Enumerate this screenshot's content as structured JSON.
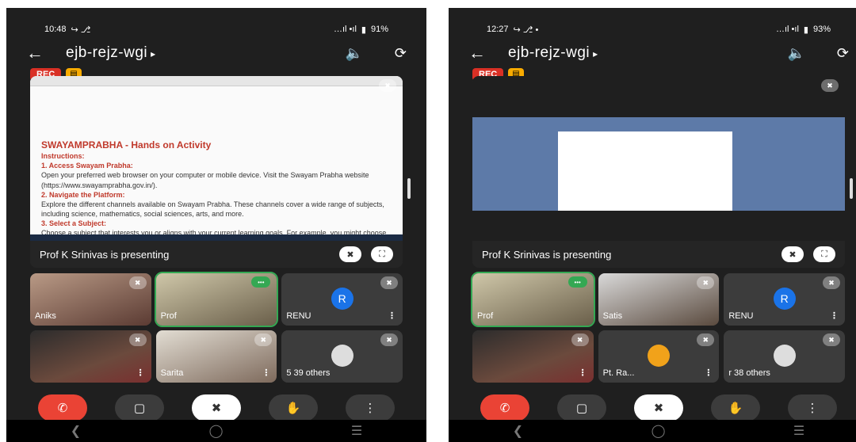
{
  "left": {
    "time": "10:48",
    "status_icons": "↪ ⎇",
    "signal": "…ıl •ıl",
    "battery": "91%",
    "meeting_code": "ejb-rejz-wgi",
    "rec": "REC",
    "presenting": "Prof K Srinivas is presenting",
    "doc_title": "SWAYAMPRABHA - Hands on Activity",
    "doc_instructions": "Instructions:",
    "doc_step1": "1. Access Swayam Prabha:",
    "doc_step1_text": "Open your preferred web browser on your computer or mobile device. Visit the Swayam Prabha website (https://www.swayamprabha.gov.in/).",
    "doc_step2": "2. Navigate the Platform:",
    "doc_step2_text": "Explore the different channels available on Swayam Prabha. These channels cover a wide range of subjects, including science, mathematics, social sciences, arts, and more.",
    "doc_step3": "3. Select a Subject:",
    "doc_step3_text": "Choose a subject that interests you or aligns with your current learning goals. For example, you might choose a channel related to your school or",
    "participants": [
      {
        "name": "Aniks"
      },
      {
        "name": "Prof"
      },
      {
        "name": "RENU",
        "initial": "R"
      },
      {
        "name": ""
      },
      {
        "name": "Sarita"
      },
      {
        "name": "5 39 others"
      }
    ]
  },
  "right": {
    "time": "12:27",
    "status_icons": "↪ ⎇ •",
    "signal": "…ıl •ıl",
    "battery": "93%",
    "meeting_code": "ejb-rejz-wgi",
    "rec": "REC",
    "presenting": "Prof K Srinivas is presenting",
    "participants": [
      {
        "name": "Prof"
      },
      {
        "name": "Satis"
      },
      {
        "name": "RENU",
        "initial": "R"
      },
      {
        "name": ""
      },
      {
        "name": "Pt. Ra..."
      },
      {
        "name": "r 38 others"
      }
    ]
  },
  "icons": {
    "back": "arrow-left-icon",
    "audio": "speaker-icon",
    "camera_switch": "camera-switch-icon",
    "mic_off": "mic-off-icon",
    "fullscreen": "fullscreen-icon",
    "end_call": "phone-hangup-icon",
    "camera": "video-camera-icon",
    "raise_hand": "hand-icon",
    "more": "more-vert-icon"
  },
  "colors": {
    "rec": "#d93025",
    "end_call": "#ea4335",
    "avatar": "#1a73e8",
    "speaking": "#34a853"
  }
}
